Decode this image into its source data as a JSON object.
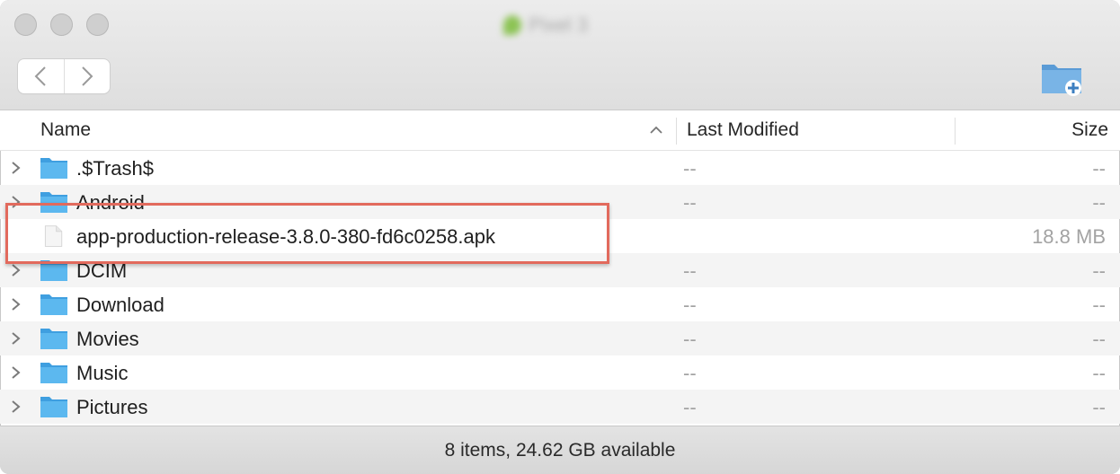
{
  "window": {
    "title": "Pixel 3",
    "controls": [
      "close",
      "minimize",
      "zoom"
    ]
  },
  "toolbar": {
    "back_icon": "chevron-left-icon",
    "forward_icon": "chevron-right-icon",
    "new_folder_icon": "new-folder-icon"
  },
  "columns": {
    "name": "Name",
    "last_modified": "Last Modified",
    "size": "Size"
  },
  "files": [
    {
      "name": ".$Trash$",
      "type": "folder",
      "modified": "--",
      "size": "--"
    },
    {
      "name": "Android",
      "type": "folder",
      "modified": "--",
      "size": "--"
    },
    {
      "name": "app-production-release-3.8.0-380-fd6c0258.apk",
      "type": "file",
      "modified": "",
      "size": "18.8 MB"
    },
    {
      "name": "DCIM",
      "type": "folder",
      "modified": "--",
      "size": "--"
    },
    {
      "name": "Download",
      "type": "folder",
      "modified": "--",
      "size": "--"
    },
    {
      "name": "Movies",
      "type": "folder",
      "modified": "--",
      "size": "--"
    },
    {
      "name": "Music",
      "type": "folder",
      "modified": "--",
      "size": "--"
    },
    {
      "name": "Pictures",
      "type": "folder",
      "modified": "--",
      "size": "--"
    }
  ],
  "status": {
    "text": "8 items, 24.62 GB available"
  },
  "colors": {
    "folder": "#5cb8ef",
    "highlight": "#e26a5d",
    "alt_row": "#f4f4f4"
  }
}
